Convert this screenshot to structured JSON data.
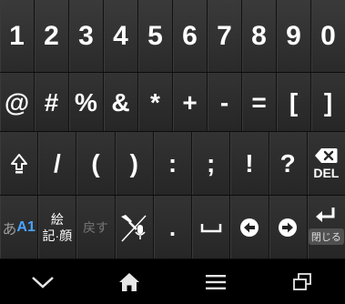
{
  "keyboard": {
    "row1": [
      "1",
      "2",
      "3",
      "4",
      "5",
      "6",
      "7",
      "8",
      "9",
      "0"
    ],
    "row2": [
      "@",
      "#",
      "%",
      "&",
      "*",
      "+",
      "-",
      "=",
      "[",
      "]"
    ],
    "row3": [
      ")",
      "(",
      ")",
      ":",
      ";",
      "!",
      "?"
    ],
    "row3_keys": {
      "slash": "/",
      "open_paren": "(",
      "close_paren": ")",
      "colon": ":",
      "semicolon": ";",
      "exclaim": "!",
      "question": "?"
    },
    "del_label": "DEL",
    "mode_label": "あ",
    "mode_label_alt": "A1",
    "emoji_label_line1": "絵",
    "emoji_label_line2": "記·顔",
    "undo_label": "戻す",
    "dot_label": ".",
    "close_label": "閉じる"
  },
  "colors": {
    "accent": "#4aa3ff",
    "key_text": "#ffffff",
    "dim_text": "#9a9a9a"
  },
  "navbar": {
    "icons": [
      "chevron-down-icon",
      "home-icon",
      "menu-icon",
      "recent-apps-icon"
    ]
  }
}
